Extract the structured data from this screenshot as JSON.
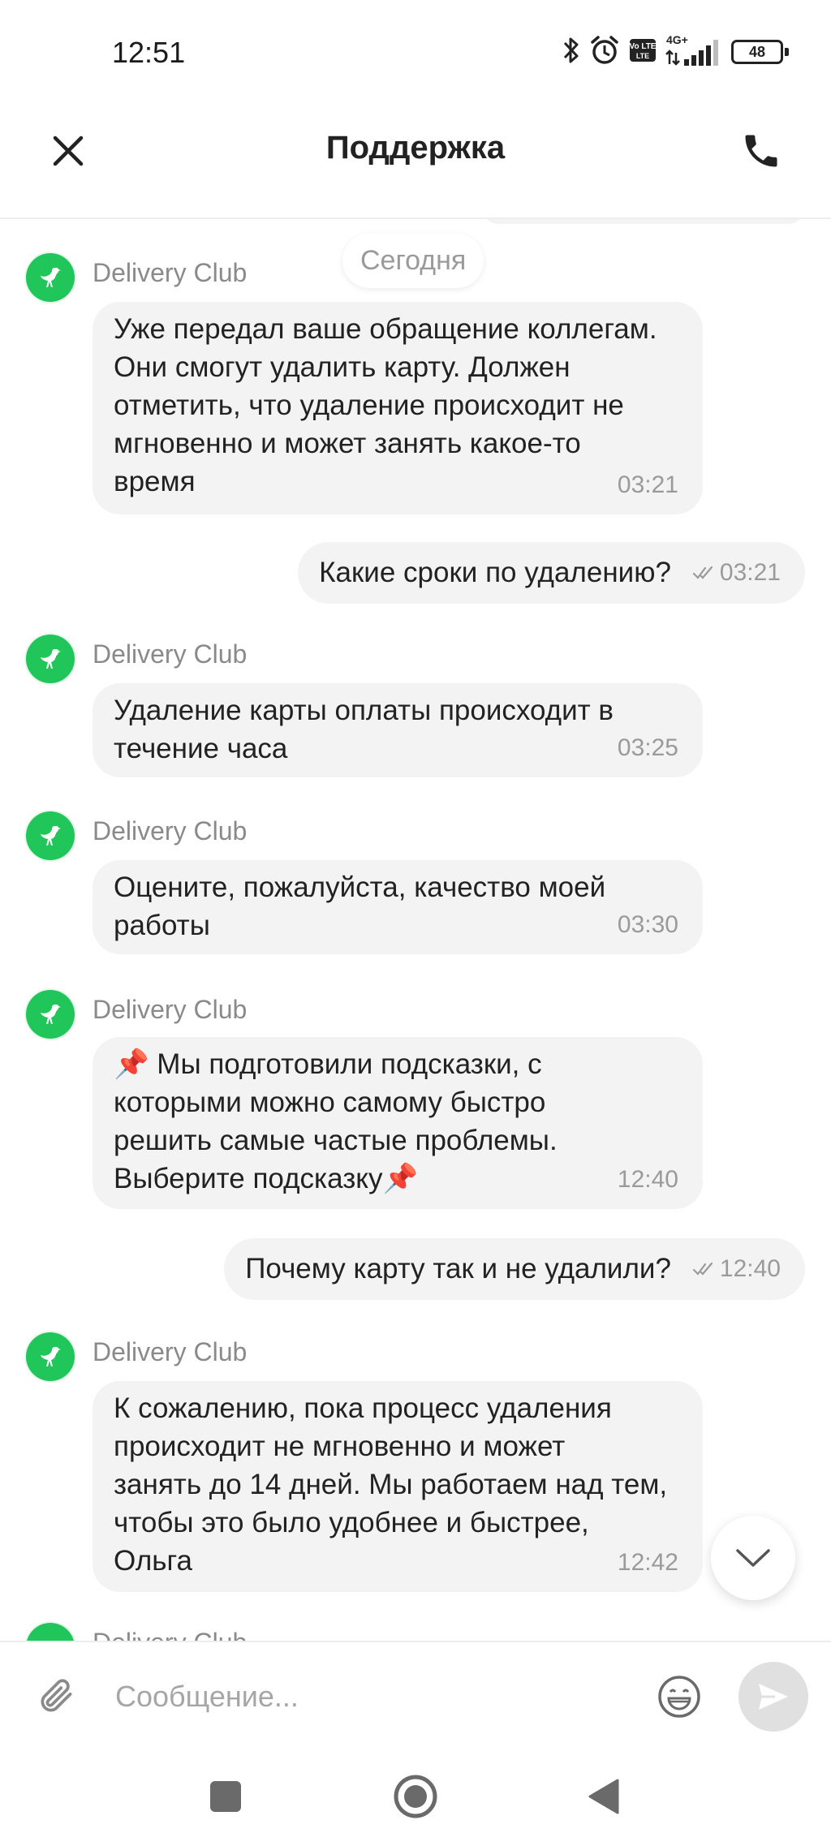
{
  "status_bar": {
    "time": "12:51",
    "network_label": "4G+",
    "volte_label": "Vo LTE",
    "battery": "48",
    "icons": [
      "bluetooth-icon",
      "alarm-icon",
      "volte-icon",
      "signal-icon",
      "battery-icon"
    ]
  },
  "header": {
    "title": "Поддержка",
    "icons": [
      "close-icon",
      "phone-icon"
    ]
  },
  "chat": {
    "date_divider": "Сегодня",
    "sender_name": "Delivery Club",
    "messages": [
      {
        "direction": "in",
        "text": "Уже передал ваше обращение коллегам.\nОни смогут удалить карту. Должен\nотметить, что удаление происходит не\nмгновенно и может занять какое-то\nвремя",
        "time": "03:21"
      },
      {
        "direction": "out",
        "text": "Какие сроки по удалению?",
        "time": "03:21",
        "status_icon": "double-check-icon"
      },
      {
        "direction": "in",
        "text": "Удаление карты оплаты происходит в\nтечение часа",
        "time": "03:25"
      },
      {
        "direction": "in",
        "text": "Оцените, пожалуйста, качество моей\nработы",
        "time": "03:30"
      },
      {
        "direction": "in",
        "text": "📌 Мы подготовили подсказки, с\nкоторыми можно самому быстро\nрешить самые частые проблемы.\nВыберите подсказку📌",
        "time": "12:40"
      },
      {
        "direction": "out",
        "text": "Почему карту так и не удалили?",
        "time": "12:40",
        "status_icon": "double-check-icon"
      },
      {
        "direction": "in",
        "text": "К сожалению, пока процесс удаления\nпроисходит не мгновенно и может\nзанять до 14 дней. Мы работаем над тем,\nчтобы это было удобнее и быстрее,\nОльга",
        "time": "12:42"
      }
    ]
  },
  "composer": {
    "placeholder": "Сообщение...",
    "icons": [
      "paperclip-icon",
      "emoji-icon",
      "send-icon"
    ]
  },
  "nav_bar": {
    "icons": [
      "recents-square-icon",
      "home-circle-icon",
      "back-triangle-icon"
    ]
  },
  "colors": {
    "brand_green": "#21c65b",
    "bubble_bg": "#f3f3f3",
    "muted_text": "#9a9a9a",
    "send_button_disabled": "#e0e0e0"
  }
}
